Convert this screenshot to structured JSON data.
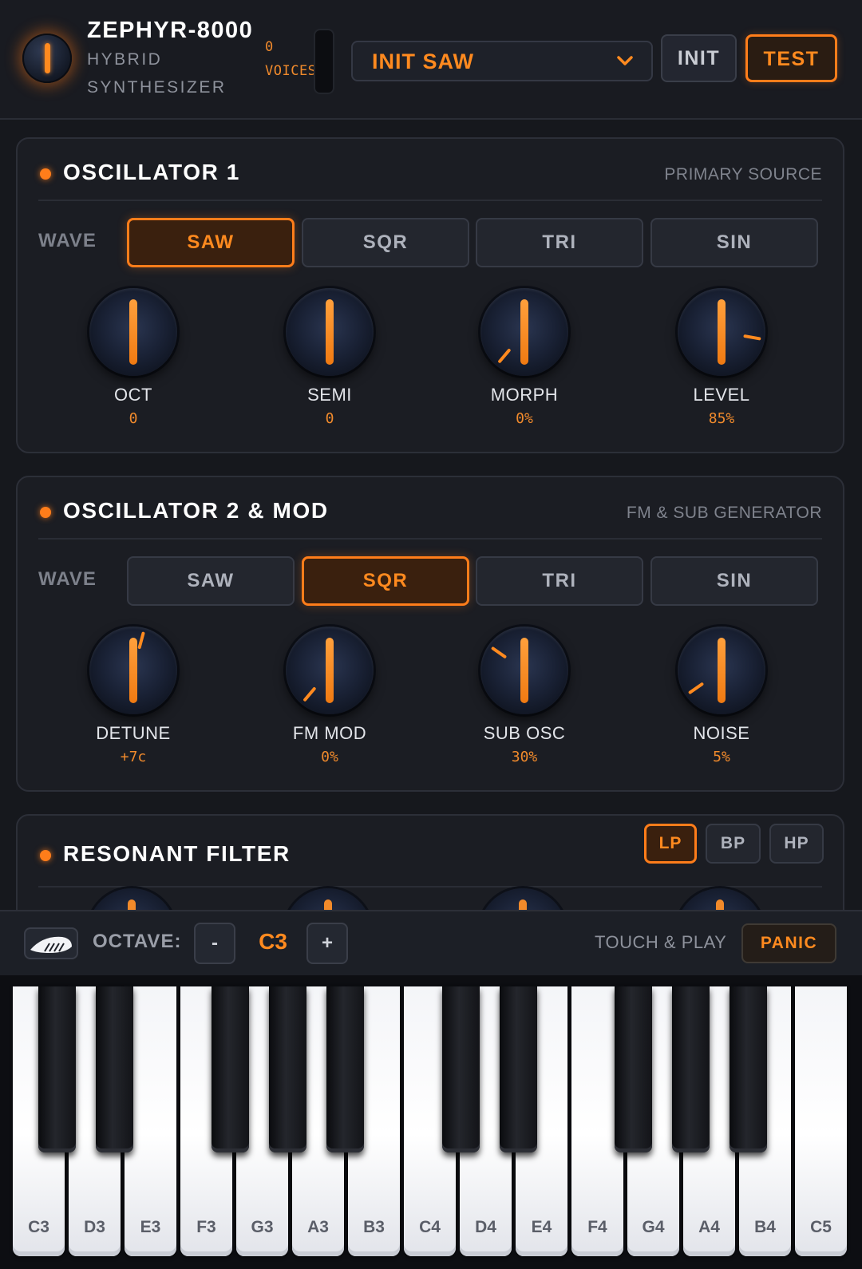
{
  "header": {
    "title": "ZEPHYR-8000",
    "subtitle_line1": "HYBRID",
    "subtitle_line2": "SYNTHESIZER",
    "voices_count": "0",
    "voices_label": "VOICES",
    "preset": "INIT SAW",
    "init_label": "INIT",
    "test_label": "TEST"
  },
  "osc1": {
    "title": "OSCILLATOR 1",
    "subtitle": "PRIMARY SOURCE",
    "wave_label": "WAVE",
    "waves": [
      "SAW",
      "SQR",
      "TRI",
      "SIN"
    ],
    "active_wave": "SAW",
    "knobs": [
      {
        "label": "OCT",
        "value": "0"
      },
      {
        "label": "SEMI",
        "value": "0"
      },
      {
        "label": "MORPH",
        "value": "0%"
      },
      {
        "label": "LEVEL",
        "value": "85%"
      }
    ]
  },
  "osc2": {
    "title": "OSCILLATOR 2 & MOD",
    "subtitle": "FM & SUB GENERATOR",
    "wave_label": "WAVE",
    "waves": [
      "SAW",
      "SQR",
      "TRI",
      "SIN"
    ],
    "active_wave": "SQR",
    "knobs": [
      {
        "label": "DETUNE",
        "value": "+7c"
      },
      {
        "label": "FM MOD",
        "value": "0%"
      },
      {
        "label": "SUB OSC",
        "value": "30%"
      },
      {
        "label": "NOISE",
        "value": "5%"
      }
    ]
  },
  "filter": {
    "title": "RESONANT FILTER",
    "modes": [
      "LP",
      "BP",
      "HP"
    ],
    "active_mode": "LP"
  },
  "keyboard_bar": {
    "octave_label": "OCTAVE:",
    "octave_down": "-",
    "octave_value": "C3",
    "octave_up": "+",
    "touch_label": "TOUCH & PLAY",
    "panic_label": "PANIC"
  },
  "keys": {
    "white": [
      "C3",
      "D3",
      "E3",
      "F3",
      "G3",
      "A3",
      "B3",
      "C4",
      "D4",
      "E4",
      "F4",
      "G4",
      "A4",
      "B4",
      "C5"
    ]
  },
  "colors": {
    "accent": "#ff7d1a",
    "panel": "#1b1d23",
    "background": "#16181d"
  }
}
